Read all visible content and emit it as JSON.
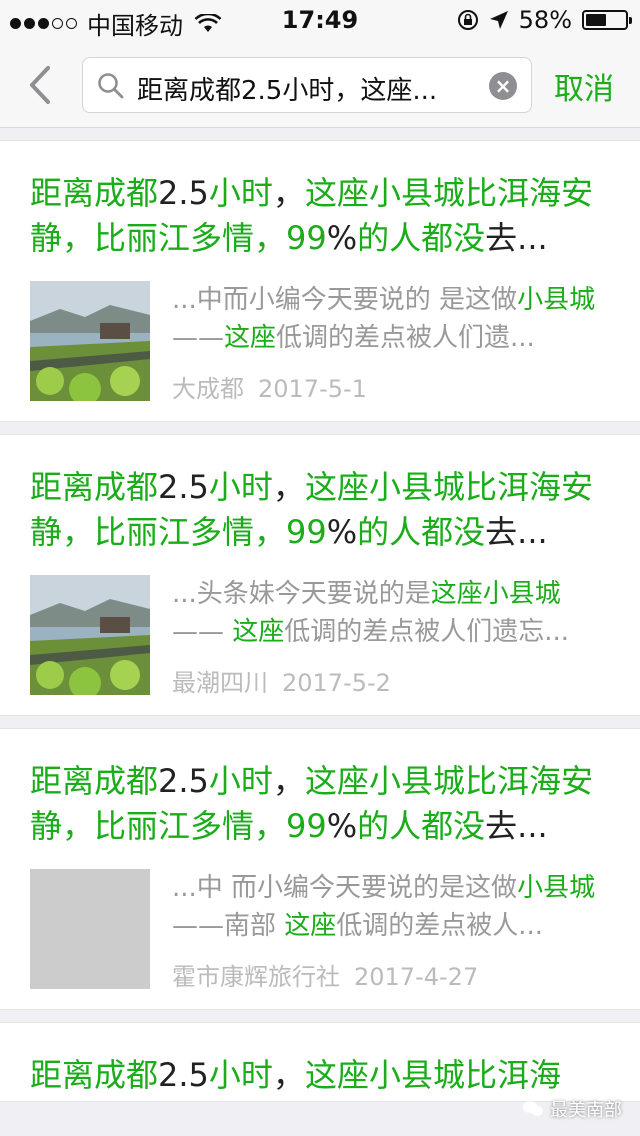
{
  "status_bar": {
    "carrier": "中国移动",
    "time": "17:49",
    "battery": "58%",
    "battery_level": 0.58
  },
  "search": {
    "query": "距离成都2.5小时，这座...",
    "cancel_label": "取消"
  },
  "results": [
    {
      "title_a": "距离成都",
      "title_b": "2.5",
      "title_c": "小时",
      "title_d": "，",
      "title_e": "这座小县城比洱海安静，比丽江多情，99",
      "title_f": "%",
      "title_g": "的人都没",
      "title_h": "去...",
      "snippet_a": "...中而小编今天要说的 是这做",
      "snippet_b": "小县城",
      "snippet_c": "——",
      "snippet_d": "这座",
      "snippet_e": "低调的差点被人们遗...",
      "source": "大成都",
      "date": "2017-5-1"
    },
    {
      "title_a": "距离成都",
      "title_b": "2.5",
      "title_c": "小时",
      "title_d": "，",
      "title_e": "这座小县城比洱海安静，比丽江多情，99",
      "title_f": "%",
      "title_g": "的人都没",
      "title_h": "去...",
      "snippet_a": "...头条妹今天要说的是",
      "snippet_b": "这座小县城",
      "snippet_c": "—— ",
      "snippet_d": "这座",
      "snippet_e": "低调的差点被人们遗忘...",
      "source": "最潮四川",
      "date": "2017-5-2"
    },
    {
      "title_a": "距离成都",
      "title_b": "2.5",
      "title_c": "小时",
      "title_d": "，",
      "title_e": "这座小县城比洱海安静，比丽江多情，99",
      "title_f": "%",
      "title_g": "的人都没",
      "title_h": "去...",
      "snippet_a": "...中 而小编今天要说的是这做",
      "snippet_b": "小县城",
      "snippet_c": "——南部 ",
      "snippet_d": "这座",
      "snippet_e": "低调的差点被人...",
      "source": "霍市康辉旅行社",
      "date": "2017-4-27"
    }
  ],
  "partial_result": {
    "title_a": "距离成都",
    "title_b": "2.5",
    "title_c": "小时",
    "title_d": "，",
    "title_e": "这座小县城比洱海"
  },
  "watermark": "最美南部",
  "colors": {
    "accent": "#1aad19",
    "muted": "#999999",
    "background": "#efeff4"
  }
}
